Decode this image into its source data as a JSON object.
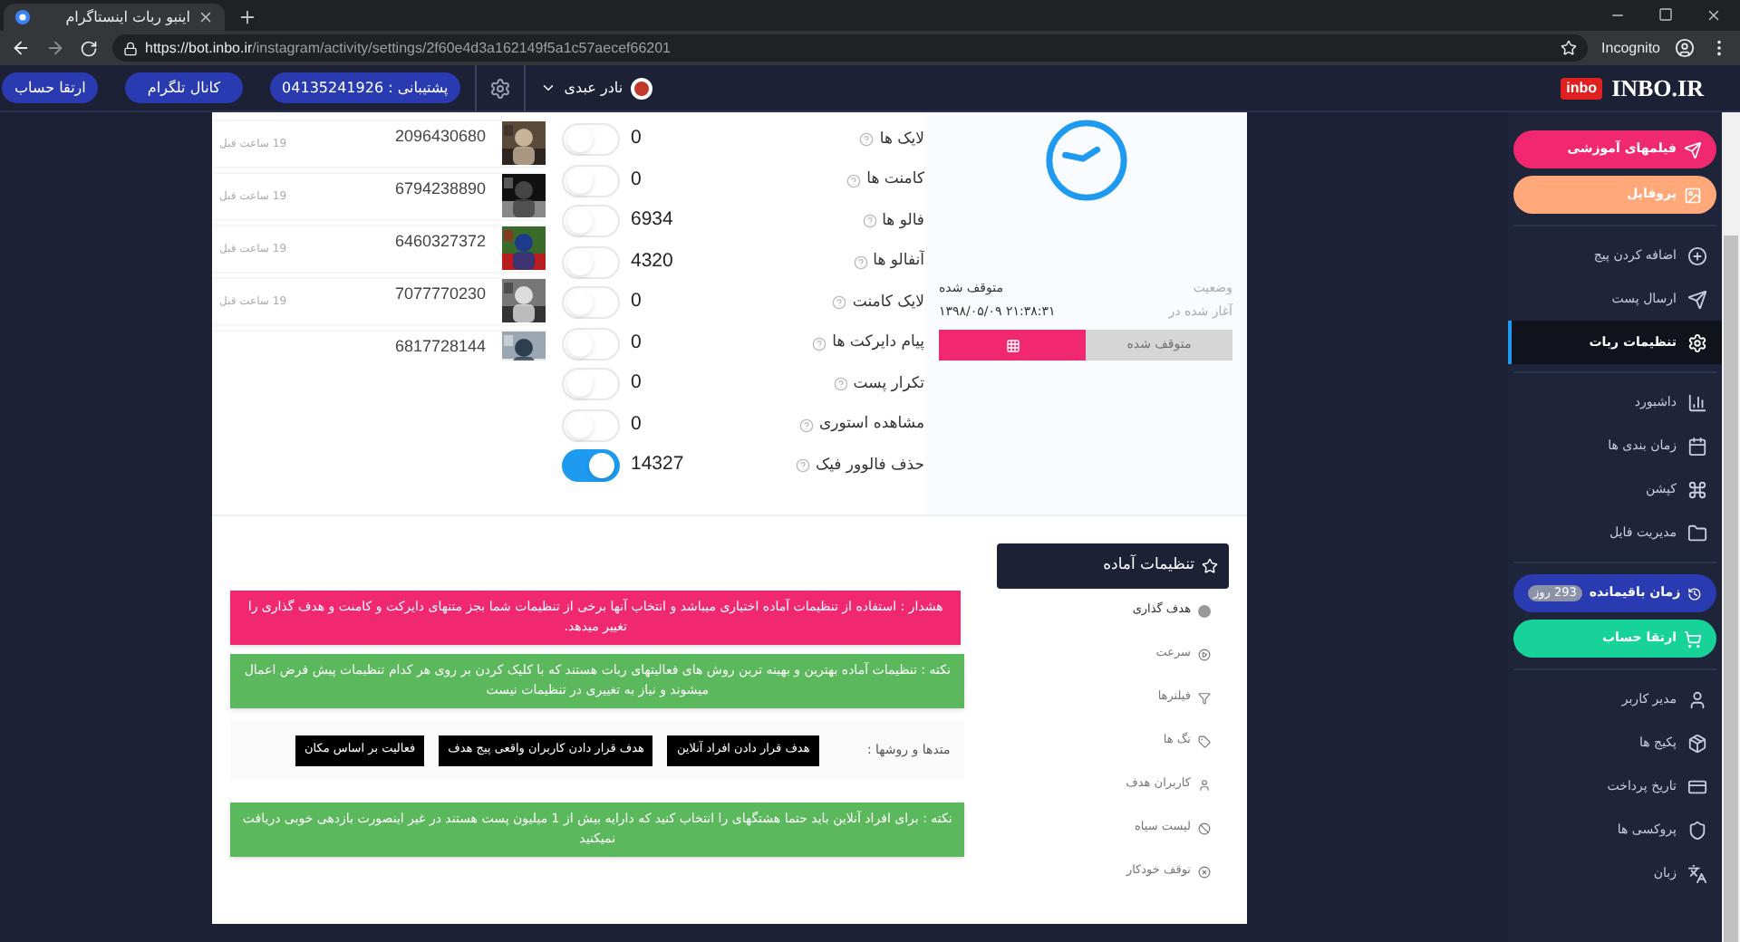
{
  "browser": {
    "tab_title": "اینبو ربات اینستاگرام",
    "url_host": "https://bot.inbo.ir",
    "url_path": "/instagram/activity/settings/2f60e4d3a162149f5a1c57aecef66201",
    "mode": "Incognito"
  },
  "header": {
    "logo": "INBO.IR",
    "logo_badge": "inbo",
    "user": "نادر عبدی",
    "support": "پشتیبانی : 04135241926",
    "telegram": "کانال تلگرام",
    "upgrade": "ارتقا حساب"
  },
  "activities": [
    {
      "id": "2096430680",
      "time": "19 ساعت قبل"
    },
    {
      "id": "6794238890",
      "time": "19 ساعت قبل"
    },
    {
      "id": "6460327372",
      "time": "19 ساعت قبل"
    },
    {
      "id": "7077770230",
      "time": "19 ساعت قبل"
    },
    {
      "id": "6817728144"
    }
  ],
  "stats": [
    {
      "label": "لایک ها",
      "value": "0",
      "on": false
    },
    {
      "label": "کامنت ها",
      "value": "0",
      "on": false
    },
    {
      "label": "فالو ها",
      "value": "6934",
      "on": false
    },
    {
      "label": "آنفالو ها",
      "value": "4320",
      "on": false
    },
    {
      "label": "لایک کامنت",
      "value": "0",
      "on": false
    },
    {
      "label": "پیام دایرکت ها",
      "value": "0",
      "on": false
    },
    {
      "label": "تکرار پست",
      "value": "0",
      "on": false
    },
    {
      "label": "مشاهده استوری",
      "value": "0",
      "on": false
    },
    {
      "label": "حذف فالوور فیک",
      "value": "14327",
      "on": true
    }
  ],
  "status": {
    "status_label": "وضعیت",
    "status_value": "متوقف شده",
    "started_label": "آغاز شده در",
    "started_value": "۲۱:۳۸:۳۱ ۱۳۹۸/۰۵/۰۹",
    "stop_button": "متوقف شده"
  },
  "presets": {
    "title": "تنظیمات آماده",
    "items": [
      {
        "label": "هدف گذاری",
        "selected": true
      },
      {
        "label": "سرعت",
        "selected": false
      },
      {
        "label": "فیلترها",
        "selected": false
      },
      {
        "label": "تگ ها",
        "selected": false
      },
      {
        "label": "کاربران هدف",
        "selected": false
      },
      {
        "label": "لیست سیاه",
        "selected": false
      },
      {
        "label": "توقف خودکار",
        "selected": false
      }
    ]
  },
  "notices": [
    {
      "kind": "warning",
      "text": "هشدار : استفاده از تنظیمات آماده اختیاری میباشد و انتخاب آنها برخی از تنظیمات شما بجز متنهای دایرکت و کامنت و هدف گذاری را تغییر میدهد."
    },
    {
      "kind": "note",
      "text": "نکته : تنظیمات آماده بهترین و بهینه ترین روش های فعالیتهای ربات هستند که با کلیک کردن بر روی هر کدام تنظیمات پیش فرض اعمال میشوند و نیاز به تغییری در تنظیمات نیست"
    },
    {
      "kind": "methods",
      "label": "متدها و روشها :",
      "buttons": [
        "هدف قرار دادن افراد آنلاین",
        "هدف قرار دادن کاربران واقعی پیج هدف",
        "فعالیت بر اساس مکان"
      ]
    },
    {
      "kind": "note",
      "text": "نکته : برای افراد آنلاین باید حتما هشتگهای را انتخاب کنید که دارایه بیش از 1 میلیون پست هستند در غیر اینصورت بازدهی خوبی دریافت نمیکنید"
    }
  ],
  "sidebar": [
    {
      "kind": "pill",
      "label": "فیلمهای آموزشی",
      "color": "#f0286f"
    },
    {
      "kind": "pill",
      "label": "پروفایل",
      "color": "#ffa87a"
    },
    {
      "kind": "divider"
    },
    {
      "kind": "nav",
      "label": "اضافه کردن پیج",
      "selected": false
    },
    {
      "kind": "nav",
      "label": "ارسال پست",
      "selected": false
    },
    {
      "kind": "nav",
      "label": "تنظیمات ربات",
      "selected": true
    },
    {
      "kind": "divider"
    },
    {
      "kind": "nav",
      "label": "داشبورد",
      "selected": false
    },
    {
      "kind": "nav",
      "label": "زمان بندی ها",
      "selected": false
    },
    {
      "kind": "nav",
      "label": "کپشن",
      "selected": false
    },
    {
      "kind": "nav",
      "label": "مدیریت فایل",
      "selected": false
    },
    {
      "kind": "divider"
    },
    {
      "kind": "pill",
      "label": "زمان باقیمانده",
      "badge": "293 روز",
      "color": "#2a3ab0"
    },
    {
      "kind": "pill",
      "label": "ارتقا حساب",
      "color": "#17d39a"
    },
    {
      "kind": "divider"
    },
    {
      "kind": "nav",
      "label": "مدیر کاربر",
      "selected": false
    },
    {
      "kind": "nav",
      "label": "پکیج ها",
      "selected": false
    },
    {
      "kind": "nav",
      "label": "تاریخ پرداخت",
      "selected": false
    },
    {
      "kind": "nav",
      "label": "پروکسی ها",
      "selected": false
    },
    {
      "kind": "nav",
      "label": "زبان",
      "selected": false
    }
  ]
}
